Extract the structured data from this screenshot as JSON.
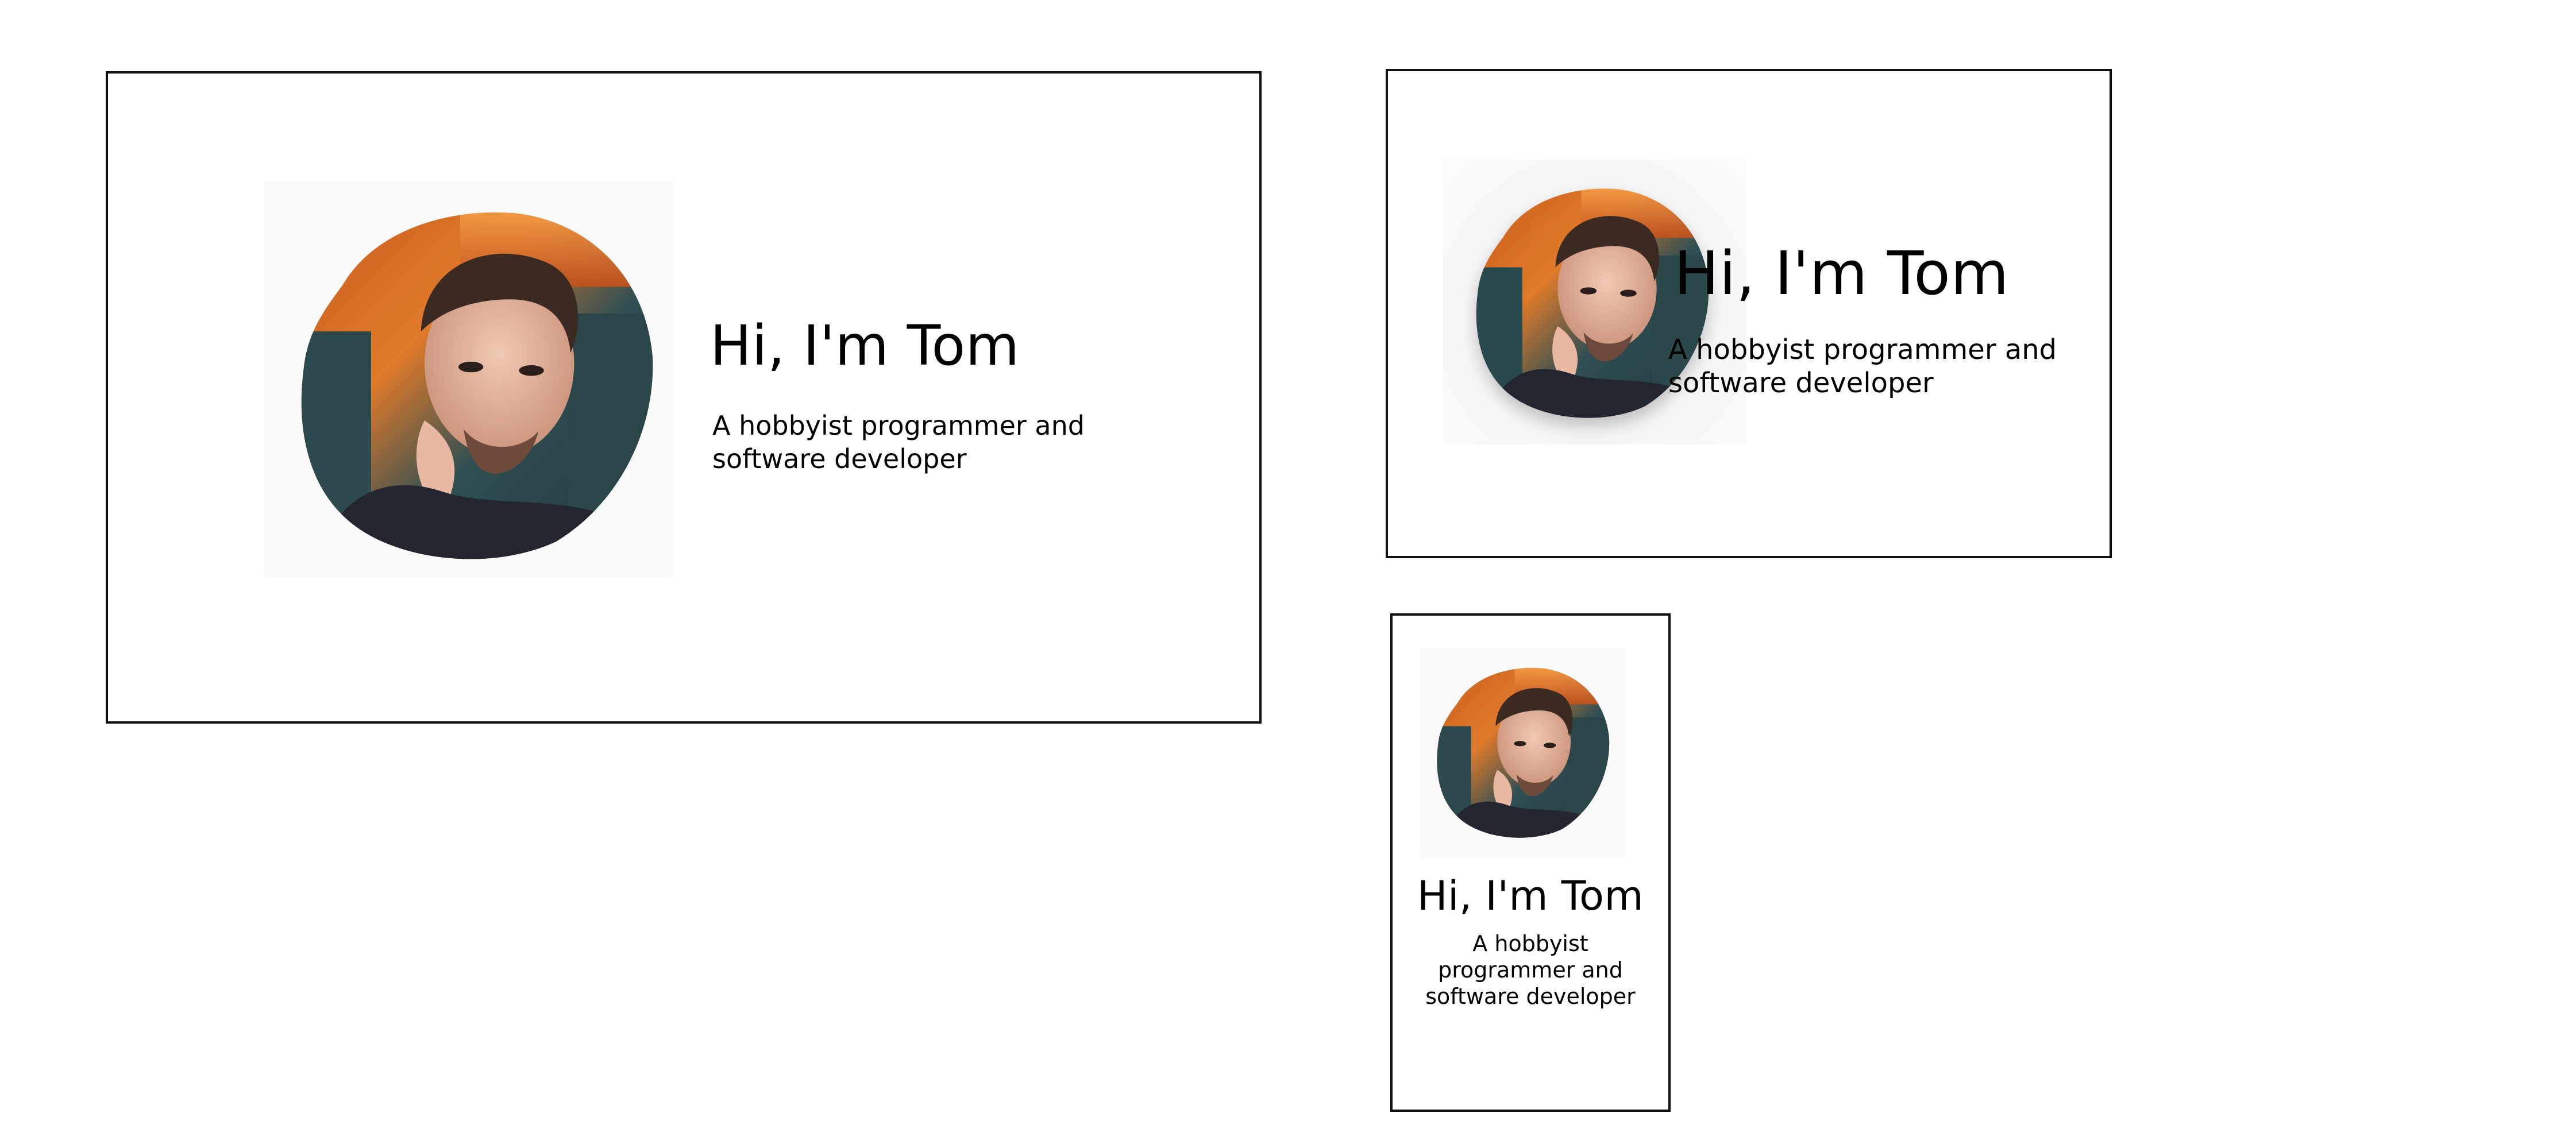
{
  "cards": {
    "large": {
      "heading": "Hi, I'm Tom",
      "tagline": "A hobbyist programmer and software developer"
    },
    "medium": {
      "heading": "Hi, I'm Tom",
      "tagline": "A hobbyist programmer and software developer"
    },
    "small": {
      "heading": "Hi, I'm Tom",
      "tagline": "A hobbyist programmer and software developer"
    }
  },
  "colors": {
    "background": "#ffffff",
    "border": "#111111",
    "text": "#000000",
    "photo_backdrop": "#fafafa"
  }
}
